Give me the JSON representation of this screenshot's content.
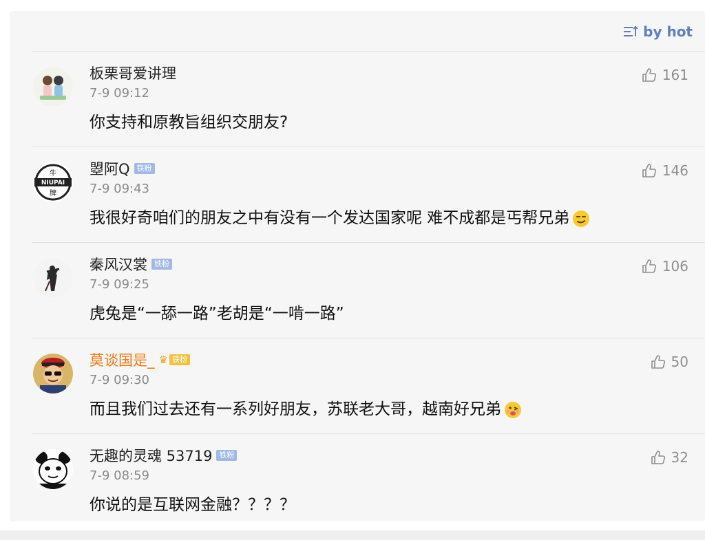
{
  "sort": {
    "label": "by hot",
    "icon": "sort-icon"
  },
  "colors": {
    "accent": "#5f7fbf",
    "vip_name": "#f07a13",
    "badge": "#9fb9e6"
  },
  "comments": [
    {
      "username": "板栗哥爱讲理",
      "badge": "",
      "time": "7-9 09:12",
      "text": "你支持和原教旨组织交朋友?",
      "likes": "161",
      "avatar": "cartoon-couple-avatar"
    },
    {
      "username": "曌阿Q",
      "badge": "铁粉",
      "time": "7-9 09:43",
      "text": "我很好奇咱们的朋友之中有没有一个发达国家呢 难不成都是丐帮兄弟",
      "likes": "146",
      "avatar": "niupai-logo-avatar",
      "emoji": "smirk-emoji"
    },
    {
      "username": "秦风汉裳",
      "badge": "铁粉",
      "time": "7-9 09:25",
      "text": "虎兔是“一舔一路”老胡是“一啃一路”",
      "likes": "106",
      "avatar": "silhouette-figure-avatar"
    },
    {
      "username": "莫谈国是_",
      "badge": "铁粉",
      "time": "7-9 09:30",
      "text": "而且我们过去还有一系列好朋友，苏联老大哥，越南好兄弟",
      "likes": "50",
      "avatar": "cartoon-official-avatar",
      "emoji": "tongue-emoji",
      "vip": true
    },
    {
      "username": "无趣的灵魂 53719",
      "badge": "铁粉",
      "time": "7-9 08:59",
      "text": "你说的是互联网金融？？？？",
      "likes": "32",
      "avatar": "panda-meme-avatar"
    }
  ]
}
